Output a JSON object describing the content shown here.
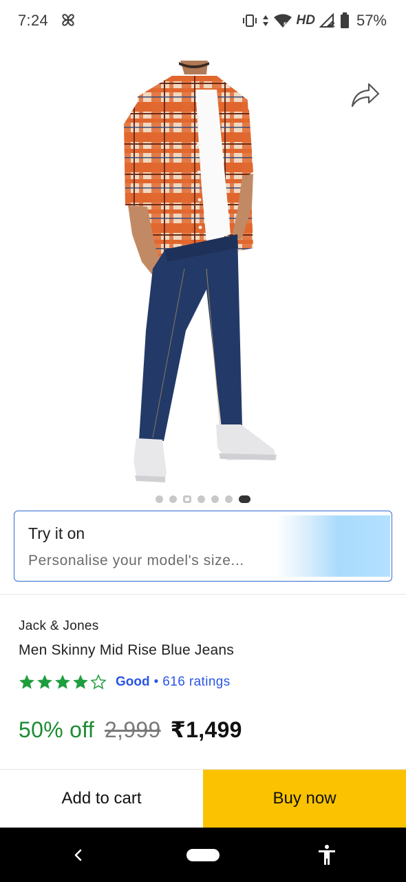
{
  "status_bar": {
    "time": "7:24",
    "network_label": "HD",
    "battery_percent": "57%",
    "icons": [
      "pinwheel-icon",
      "vibrate-icon",
      "data-arrows-icon",
      "wifi-icon",
      "signal-icon",
      "battery-icon"
    ]
  },
  "gallery": {
    "image_description_icon": "model-photo",
    "share_icon": "share-icon",
    "page_count": 7,
    "active_index": 6,
    "video_index": 2
  },
  "try_on": {
    "title": "Try it on",
    "subtitle": "Personalise your model's size..."
  },
  "product": {
    "brand": "Jack & Jones",
    "name": "Men Skinny Mid Rise Blue Jeans",
    "rating": {
      "stars": 4,
      "max_stars": 5,
      "label": "Good",
      "separator": "•",
      "count": "616 ratings",
      "color": "#2a55e5",
      "star_color": "#1e9e3e"
    },
    "price": {
      "discount": "50% off",
      "mrp": "2,999",
      "price": "₹1,499",
      "discount_color": "#1b8c33"
    }
  },
  "actions": {
    "add_to_cart": "Add to cart",
    "buy_now": "Buy now",
    "buy_color": "#fac200"
  },
  "nav": {
    "back_icon": "back-icon",
    "home_icon": "home-pill-icon",
    "accessibility_icon": "accessibility-icon"
  }
}
